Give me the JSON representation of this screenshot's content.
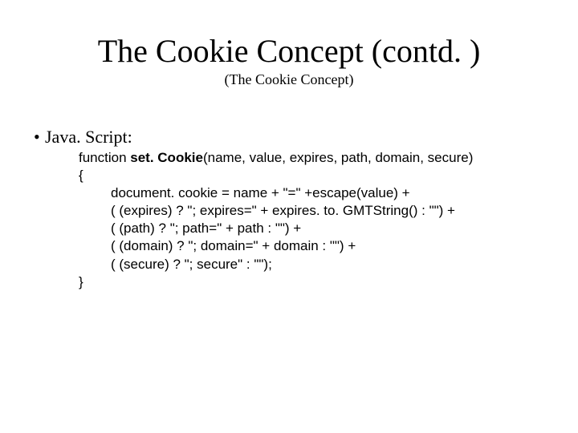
{
  "title": "The Cookie Concept (contd. )",
  "subtitle": "(The Cookie Concept)",
  "bullet": {
    "marker": "•",
    "label": "Java. Script:"
  },
  "code": {
    "l1_a": "function ",
    "l1_fn": "set. Cookie",
    "l1_b": "(name, value, expires, path, domain, secure)",
    "l2": "{",
    "l3": "document. cookie = name + \"=\" +escape(value) +",
    "l4": "( (expires) ? \"; expires=\" + expires. to. GMTString() : \"\") +",
    "l5": "( (path) ? \"; path=\" + path : \"\") +",
    "l6": "( (domain) ? \"; domain=\" + domain : \"\") +",
    "l7": "( (secure) ? \"; secure\" : \"\");",
    "l8": "}"
  }
}
